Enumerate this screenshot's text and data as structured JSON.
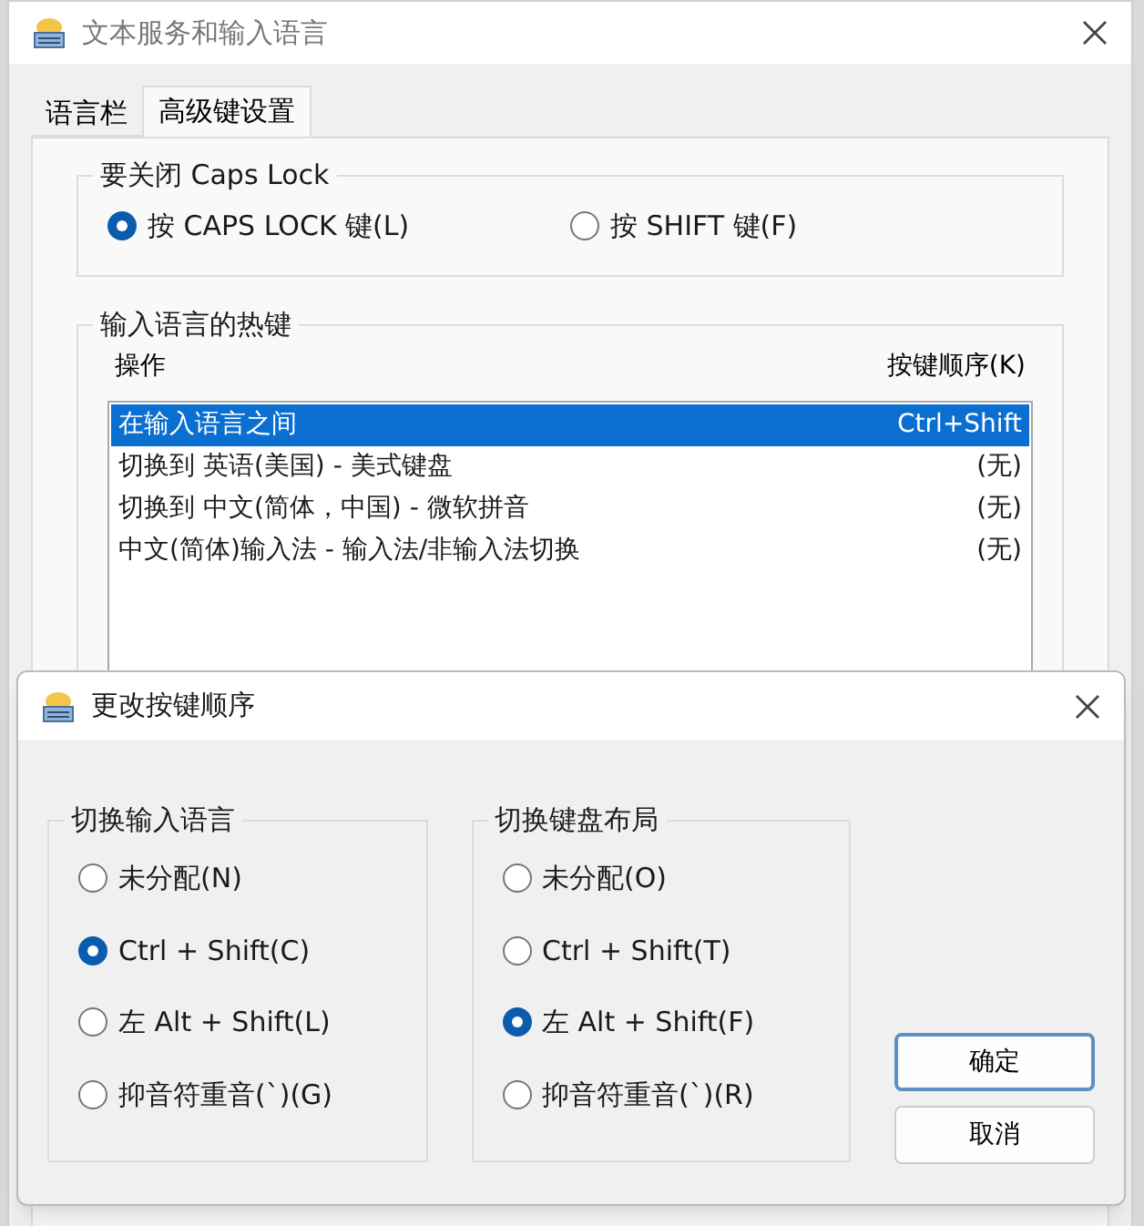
{
  "window": {
    "title": "文本服务和输入语言"
  },
  "tabs": [
    {
      "label": "语言栏",
      "selected": false
    },
    {
      "label": "高级键设置",
      "selected": true
    }
  ],
  "caps_lock_group": {
    "title": "要关闭 Caps Lock",
    "options": [
      {
        "label": "按 CAPS LOCK 键(L)",
        "selected": true
      },
      {
        "label": "按 SHIFT 键(F)",
        "selected": false
      }
    ]
  },
  "hotkeys_group": {
    "title": "输入语言的热键",
    "columns": [
      "操作",
      "按键顺序(K)"
    ],
    "rows": [
      {
        "action": "在输入语言之间",
        "keys": "Ctrl+Shift",
        "selected": true
      },
      {
        "action": "切换到 英语(美国) - 美式键盘",
        "keys": "(无)",
        "selected": false
      },
      {
        "action": "切换到 中文(简体，中国) - 微软拼音",
        "keys": "(无)",
        "selected": false
      },
      {
        "action": "中文(简体)输入法 - 输入法/非输入法切换",
        "keys": "(无)",
        "selected": false
      }
    ]
  },
  "dialog": {
    "title": "更改按键顺序",
    "groups": [
      {
        "title": "切换输入语言",
        "options": [
          {
            "label": "未分配(N)",
            "selected": false
          },
          {
            "label": "Ctrl + Shift(C)",
            "selected": true
          },
          {
            "label": "左 Alt + Shift(L)",
            "selected": false
          },
          {
            "label": "抑音符重音(`)(G)",
            "selected": false
          }
        ]
      },
      {
        "title": "切换键盘布局",
        "options": [
          {
            "label": "未分配(O)",
            "selected": false
          },
          {
            "label": "Ctrl + Shift(T)",
            "selected": false
          },
          {
            "label": "左 Alt + Shift(F)",
            "selected": true
          },
          {
            "label": "抑音符重音(`)(R)",
            "selected": false
          }
        ]
      }
    ],
    "buttons": [
      {
        "label": "确定",
        "default": true
      },
      {
        "label": "取消",
        "default": false
      }
    ]
  }
}
